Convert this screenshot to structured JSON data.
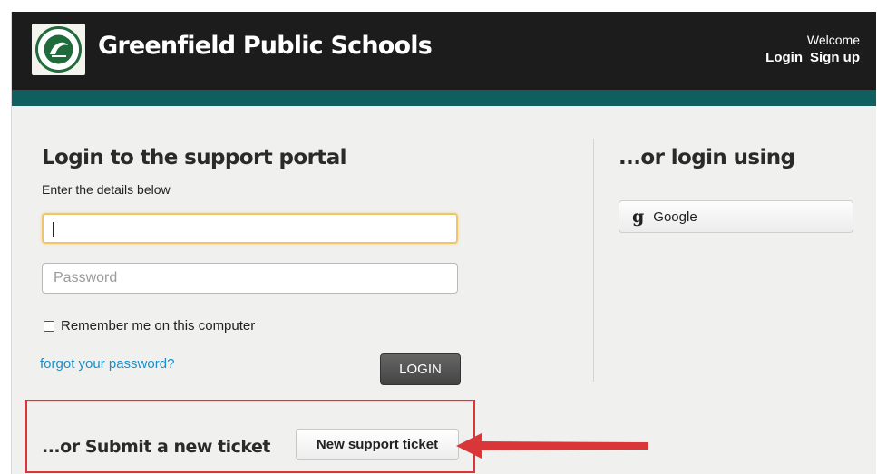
{
  "header": {
    "logo_icon": "school-seal-logo",
    "title": "Greenfield Public Schools",
    "welcome": "Welcome",
    "login_link": "Login",
    "signup_link": "Sign up",
    "bar_color": "#1c1c1c",
    "stripe_color": "#0f5f5f"
  },
  "login_form": {
    "title": "Login to the support portal",
    "subtitle": "Enter the details below",
    "username_value": "",
    "password_placeholder": "Password",
    "remember_label": "Remember me on this computer",
    "remember_checked": false,
    "forgot_link": "forgot your password?",
    "login_button": "LOGIN"
  },
  "alt_login": {
    "title": "...or login using",
    "google_icon": "google-g-icon",
    "google_label": "Google"
  },
  "ticket": {
    "label": "...or Submit a new ticket",
    "button": "New support ticket",
    "highlight_color": "#d9363a"
  }
}
